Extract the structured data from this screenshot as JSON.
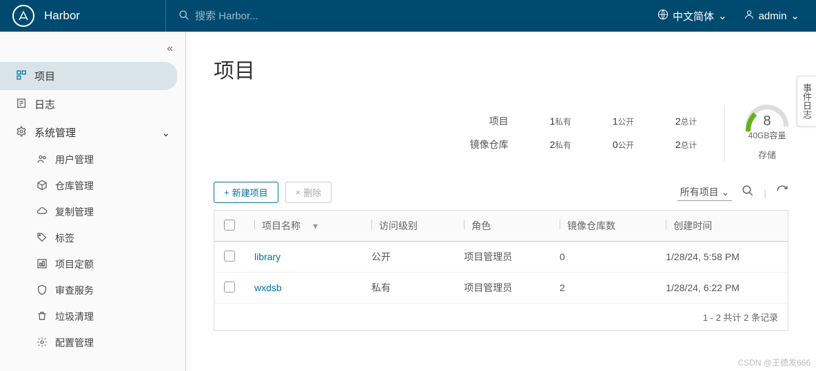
{
  "header": {
    "brand": "Harbor",
    "search_placeholder": "搜索 Harbor...",
    "language": "中文简体",
    "user": "admin"
  },
  "sidebar": {
    "projects": "项目",
    "logs": "日志",
    "system_admin": "系统管理",
    "items": [
      "用户管理",
      "仓库管理",
      "复制管理",
      "标签",
      "项目定额",
      "审查服务",
      "垃圾清理",
      "配置管理"
    ]
  },
  "page": {
    "title": "项目",
    "stat_rows": [
      "项目",
      "镜像仓库"
    ],
    "stats": {
      "proj_private": {
        "n": "1",
        "t": "私有"
      },
      "proj_public": {
        "n": "1",
        "t": "公开"
      },
      "proj_total": {
        "n": "2",
        "t": "总计"
      },
      "repo_private": {
        "n": "2",
        "t": "私有"
      },
      "repo_public": {
        "n": "0",
        "t": "公开"
      },
      "repo_total": {
        "n": "2",
        "t": "总计"
      }
    },
    "storage": {
      "value": "8",
      "capacity": "40GB容量",
      "label": "存储"
    }
  },
  "toolbar": {
    "new_project": "新建项目",
    "delete": "删除",
    "filter": "所有项目"
  },
  "table": {
    "cols": {
      "name": "项目名称",
      "access": "访问级别",
      "role": "角色",
      "repos": "镜像仓库数",
      "created": "创建时间"
    },
    "rows": [
      {
        "name": "library",
        "access": "公开",
        "role": "项目管理员",
        "repos": "0",
        "created": "1/28/24, 5:58 PM"
      },
      {
        "name": "wxdsb",
        "access": "私有",
        "role": "项目管理员",
        "repos": "2",
        "created": "1/28/24, 6:22 PM"
      }
    ],
    "footer": "1 - 2 共计 2 条记录"
  },
  "event_tab": "事件日志",
  "watermark": "CSDN @王德发666"
}
